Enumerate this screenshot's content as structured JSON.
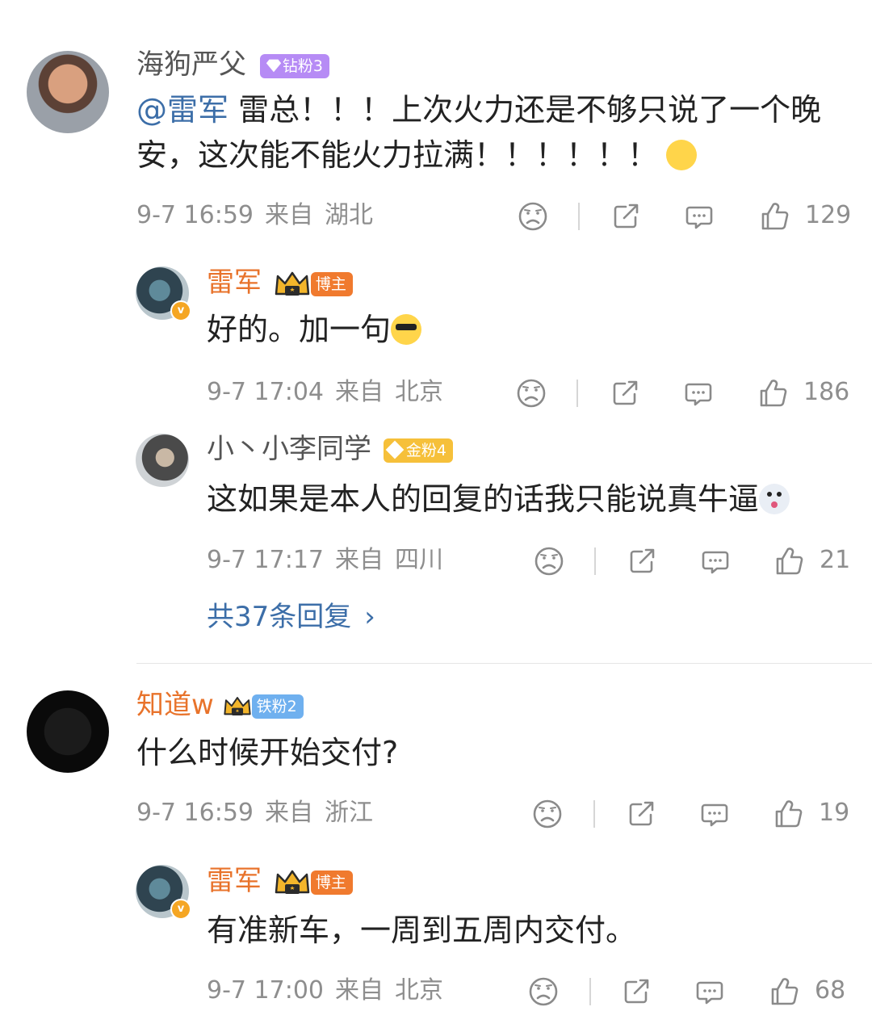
{
  "comments": [
    {
      "name": "海狗严父",
      "badge": "钻粉3",
      "mention": "@雷军",
      "text_line1": " 雷总！！！上次火力还是不够只说了一个晚",
      "text_line2": "安，这次能不能火力拉满！！！！！！",
      "time": "9-7 16:59",
      "from": "来自",
      "location": "湖北",
      "likes": "129"
    },
    {
      "name": "雷军",
      "badge": "博主",
      "text": "好的。加一句",
      "time": "9-7 17:04",
      "from": "来自",
      "location": "北京",
      "likes": "186"
    },
    {
      "name": "小丶小李同学",
      "badge": "金粉4",
      "text": "这如果是本人的回复的话我只能说真牛逼",
      "time": "9-7 17:17",
      "from": "来自",
      "location": "四川",
      "likes": "21"
    },
    {
      "name": "知道w",
      "badge": "铁粉2",
      "text": "什么时候开始交付?",
      "time": "9-7 16:59",
      "from": "来自",
      "location": "浙江",
      "likes": "19"
    },
    {
      "name": "雷军",
      "badge": "博主",
      "text": "有准新车，一周到五周内交付。",
      "time": "9-7 17:00",
      "from": "来自",
      "location": "北京",
      "likes": "68"
    }
  ],
  "more_replies": "共37条回复",
  "more_replies_chevron": "›",
  "colors": {
    "name_orange": "#e8732b",
    "link_blue": "#3c6ea8",
    "meta_gray": "#8e8e8e",
    "badge_purple": "#b68bf5",
    "badge_gold": "#f6c03a",
    "badge_blue": "#6fb0ef",
    "badge_host": "#f07a2e"
  },
  "icons": [
    "sad-face-icon",
    "share-icon",
    "comment-icon",
    "like-icon",
    "verified-icon",
    "crown-icon",
    "diamond-icon"
  ]
}
